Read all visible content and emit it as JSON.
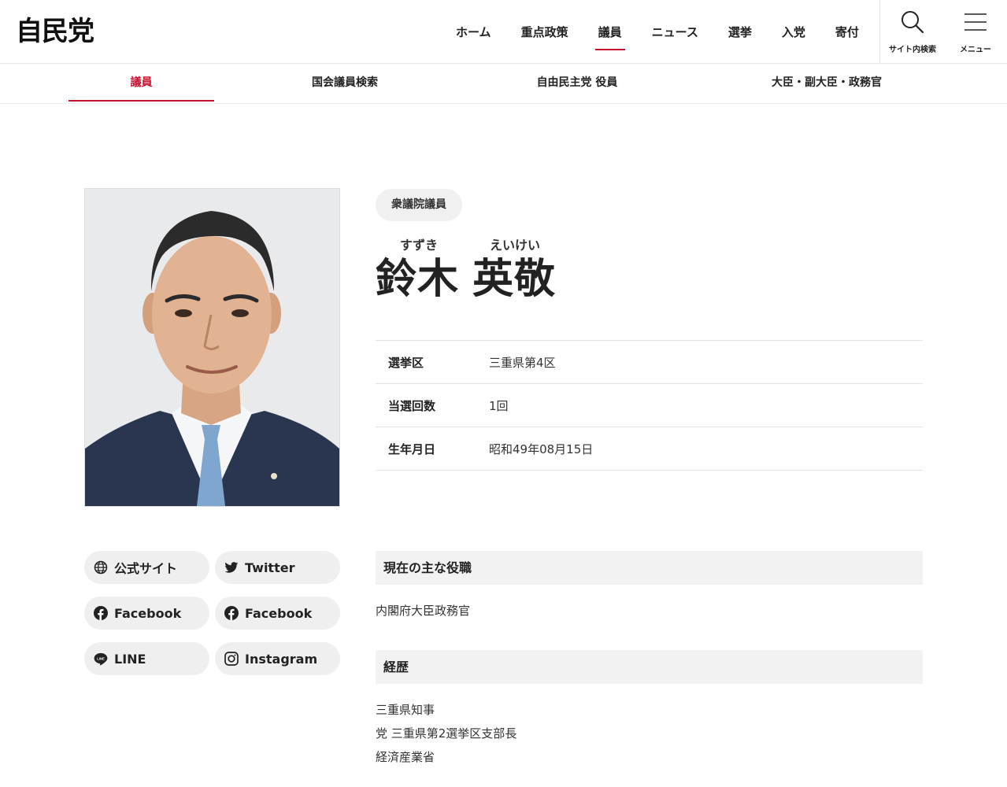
{
  "header": {
    "logo": "自民党",
    "nav": [
      "ホーム",
      "重点政策",
      "議員",
      "ニュース",
      "選挙",
      "入党",
      "寄付"
    ],
    "active_nav": "議員",
    "search_label": "サイト内検索",
    "menu_label": "メニュー"
  },
  "subnav": {
    "items": [
      "議員",
      "国会議員検索",
      "自由民主党 役員",
      "大臣・副大臣・政務官"
    ],
    "active": "議員"
  },
  "profile": {
    "chamber": "衆議院議員",
    "family_name": "鈴木",
    "given_name": "英敬",
    "family_ruby": "すずき",
    "given_ruby": "えいけい",
    "info": [
      {
        "key": "選挙区",
        "value": "三重県第4区"
      },
      {
        "key": "当選回数",
        "value": "1回"
      },
      {
        "key": "生年月日",
        "value": "昭和49年08月15日"
      }
    ]
  },
  "social": [
    {
      "label": "公式サイト",
      "icon": "globe-icon"
    },
    {
      "label": "Twitter",
      "icon": "twitter-icon"
    },
    {
      "label": "Facebook",
      "icon": "facebook-icon"
    },
    {
      "label": "Facebook",
      "icon": "facebook-icon"
    },
    {
      "label": "LINE",
      "icon": "line-icon"
    },
    {
      "label": "Instagram",
      "icon": "instagram-icon"
    }
  ],
  "sections": {
    "current_role_title": "現在の主な役職",
    "current_roles": [
      "内閣府大臣政務官"
    ],
    "career_title": "経歴",
    "career": [
      "三重県知事",
      "党 三重県第2選挙区支部長",
      "経済産業省"
    ]
  },
  "colors": {
    "accent": "#c8102e",
    "chip_bg": "#efefef",
    "section_bg": "#f2f2f2"
  }
}
